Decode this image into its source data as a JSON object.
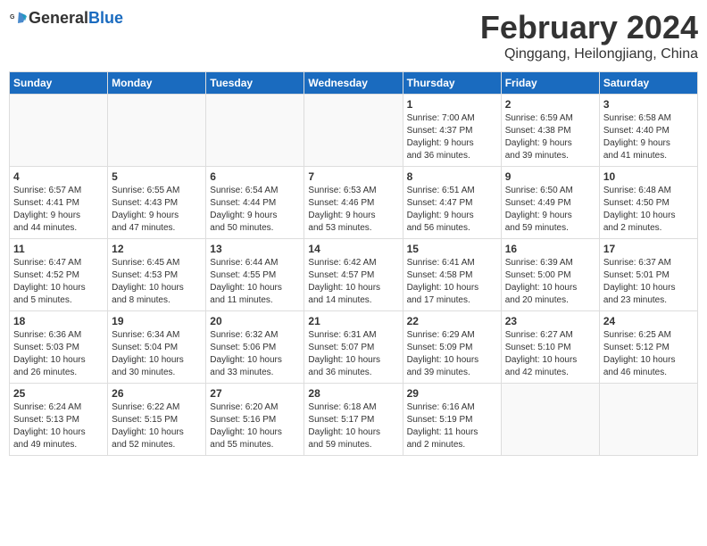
{
  "header": {
    "logo_general": "General",
    "logo_blue": "Blue",
    "month_title": "February 2024",
    "location": "Qinggang, Heilongjiang, China"
  },
  "days_of_week": [
    "Sunday",
    "Monday",
    "Tuesday",
    "Wednesday",
    "Thursday",
    "Friday",
    "Saturday"
  ],
  "weeks": [
    [
      {
        "day": "",
        "info": ""
      },
      {
        "day": "",
        "info": ""
      },
      {
        "day": "",
        "info": ""
      },
      {
        "day": "",
        "info": ""
      },
      {
        "day": "1",
        "info": "Sunrise: 7:00 AM\nSunset: 4:37 PM\nDaylight: 9 hours\nand 36 minutes."
      },
      {
        "day": "2",
        "info": "Sunrise: 6:59 AM\nSunset: 4:38 PM\nDaylight: 9 hours\nand 39 minutes."
      },
      {
        "day": "3",
        "info": "Sunrise: 6:58 AM\nSunset: 4:40 PM\nDaylight: 9 hours\nand 41 minutes."
      }
    ],
    [
      {
        "day": "4",
        "info": "Sunrise: 6:57 AM\nSunset: 4:41 PM\nDaylight: 9 hours\nand 44 minutes."
      },
      {
        "day": "5",
        "info": "Sunrise: 6:55 AM\nSunset: 4:43 PM\nDaylight: 9 hours\nand 47 minutes."
      },
      {
        "day": "6",
        "info": "Sunrise: 6:54 AM\nSunset: 4:44 PM\nDaylight: 9 hours\nand 50 minutes."
      },
      {
        "day": "7",
        "info": "Sunrise: 6:53 AM\nSunset: 4:46 PM\nDaylight: 9 hours\nand 53 minutes."
      },
      {
        "day": "8",
        "info": "Sunrise: 6:51 AM\nSunset: 4:47 PM\nDaylight: 9 hours\nand 56 minutes."
      },
      {
        "day": "9",
        "info": "Sunrise: 6:50 AM\nSunset: 4:49 PM\nDaylight: 9 hours\nand 59 minutes."
      },
      {
        "day": "10",
        "info": "Sunrise: 6:48 AM\nSunset: 4:50 PM\nDaylight: 10 hours\nand 2 minutes."
      }
    ],
    [
      {
        "day": "11",
        "info": "Sunrise: 6:47 AM\nSunset: 4:52 PM\nDaylight: 10 hours\nand 5 minutes."
      },
      {
        "day": "12",
        "info": "Sunrise: 6:45 AM\nSunset: 4:53 PM\nDaylight: 10 hours\nand 8 minutes."
      },
      {
        "day": "13",
        "info": "Sunrise: 6:44 AM\nSunset: 4:55 PM\nDaylight: 10 hours\nand 11 minutes."
      },
      {
        "day": "14",
        "info": "Sunrise: 6:42 AM\nSunset: 4:57 PM\nDaylight: 10 hours\nand 14 minutes."
      },
      {
        "day": "15",
        "info": "Sunrise: 6:41 AM\nSunset: 4:58 PM\nDaylight: 10 hours\nand 17 minutes."
      },
      {
        "day": "16",
        "info": "Sunrise: 6:39 AM\nSunset: 5:00 PM\nDaylight: 10 hours\nand 20 minutes."
      },
      {
        "day": "17",
        "info": "Sunrise: 6:37 AM\nSunset: 5:01 PM\nDaylight: 10 hours\nand 23 minutes."
      }
    ],
    [
      {
        "day": "18",
        "info": "Sunrise: 6:36 AM\nSunset: 5:03 PM\nDaylight: 10 hours\nand 26 minutes."
      },
      {
        "day": "19",
        "info": "Sunrise: 6:34 AM\nSunset: 5:04 PM\nDaylight: 10 hours\nand 30 minutes."
      },
      {
        "day": "20",
        "info": "Sunrise: 6:32 AM\nSunset: 5:06 PM\nDaylight: 10 hours\nand 33 minutes."
      },
      {
        "day": "21",
        "info": "Sunrise: 6:31 AM\nSunset: 5:07 PM\nDaylight: 10 hours\nand 36 minutes."
      },
      {
        "day": "22",
        "info": "Sunrise: 6:29 AM\nSunset: 5:09 PM\nDaylight: 10 hours\nand 39 minutes."
      },
      {
        "day": "23",
        "info": "Sunrise: 6:27 AM\nSunset: 5:10 PM\nDaylight: 10 hours\nand 42 minutes."
      },
      {
        "day": "24",
        "info": "Sunrise: 6:25 AM\nSunset: 5:12 PM\nDaylight: 10 hours\nand 46 minutes."
      }
    ],
    [
      {
        "day": "25",
        "info": "Sunrise: 6:24 AM\nSunset: 5:13 PM\nDaylight: 10 hours\nand 49 minutes."
      },
      {
        "day": "26",
        "info": "Sunrise: 6:22 AM\nSunset: 5:15 PM\nDaylight: 10 hours\nand 52 minutes."
      },
      {
        "day": "27",
        "info": "Sunrise: 6:20 AM\nSunset: 5:16 PM\nDaylight: 10 hours\nand 55 minutes."
      },
      {
        "day": "28",
        "info": "Sunrise: 6:18 AM\nSunset: 5:17 PM\nDaylight: 10 hours\nand 59 minutes."
      },
      {
        "day": "29",
        "info": "Sunrise: 6:16 AM\nSunset: 5:19 PM\nDaylight: 11 hours\nand 2 minutes."
      },
      {
        "day": "",
        "info": ""
      },
      {
        "day": "",
        "info": ""
      }
    ]
  ]
}
